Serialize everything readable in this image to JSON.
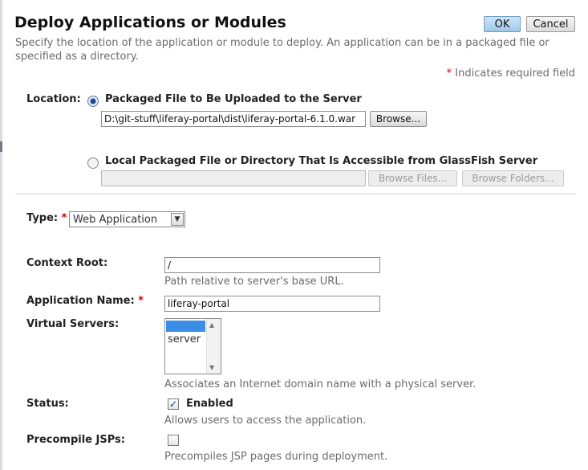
{
  "header": {
    "title": "Deploy Applications or Modules",
    "ok_label": "OK",
    "cancel_label": "Cancel"
  },
  "help_text": "Specify the location of the application or module to deploy. An application can be in a packaged file or specified as a directory.",
  "required_note": {
    "star": "*",
    "text": "Indicates required field"
  },
  "location": {
    "label": "Location:",
    "option_upload": {
      "label": "Packaged File to Be Uploaded to the Server",
      "selected": true,
      "file_value": "D:\\git-stuff\\liferay-portal\\dist\\liferay-portal-6.1.0.war",
      "browse_label": "Browse..."
    },
    "option_local": {
      "label": "Local Packaged File or Directory That Is Accessible from GlassFish Server",
      "selected": false,
      "path_value": "",
      "browse_files_label": "Browse Files...",
      "browse_folders_label": "Browse Folders..."
    }
  },
  "type": {
    "label": "Type:",
    "star": "*",
    "selected": "Web Application",
    "arrow_icon": "chevron-down-icon"
  },
  "context_root": {
    "label": "Context Root:",
    "value": "/",
    "hint": "Path relative to server's base URL."
  },
  "application_name": {
    "label": "Application Name:",
    "star": "*",
    "value": "liferay-portal"
  },
  "virtual_servers": {
    "label": "Virtual Servers:",
    "options": [
      "",
      "server"
    ],
    "hint": "Associates an Internet domain name with a physical server."
  },
  "status": {
    "label": "Status:",
    "checked": true,
    "checkbox_label": "Enabled",
    "hint": "Allows users to access the application."
  },
  "precompile": {
    "label": "Precompile JSPs:",
    "checked": false,
    "hint": "Precompiles JSP pages during deployment."
  },
  "colors": {
    "primary_button": "#9ec8e8",
    "required_star": "#cc0000",
    "selection": "#3a8ee6"
  }
}
